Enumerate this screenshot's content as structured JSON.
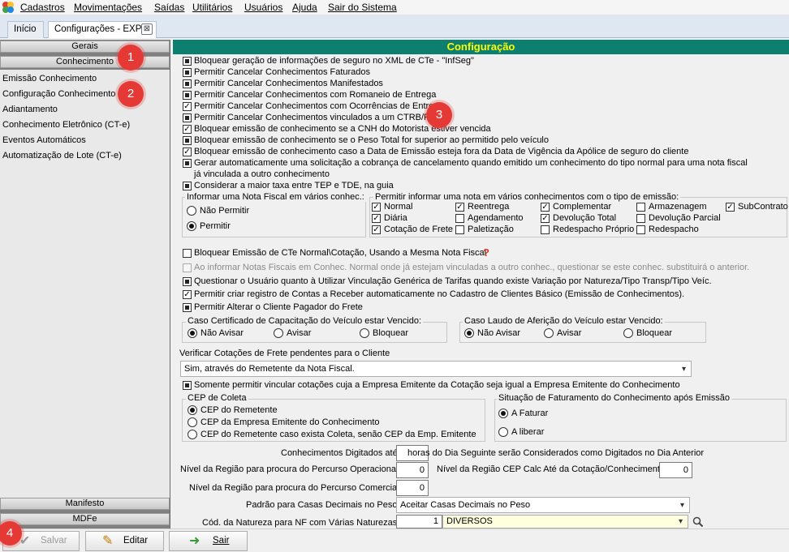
{
  "menu": [
    "Cadastros",
    "Movimentações",
    "Saídas",
    "Utilitários",
    "Usuários",
    "Ajuda",
    "Sair do Sistema"
  ],
  "tabs": [
    "Início",
    "Configurações - EXP"
  ],
  "tab_close_glyph": "⊠",
  "sidebar": {
    "groups_top": [
      "Gerais",
      "Conhecimento"
    ],
    "items": [
      "Emissão Conhecimento",
      "Configuração Conhecimento",
      "Adiantamento",
      "Conhecimento Eletrônico (CT-e)",
      "Eventos Automáticos",
      "Automatização de Lote (CT-e)"
    ],
    "groups_bottom": [
      "Manifesto",
      "MDFe"
    ]
  },
  "badges": [
    "1",
    "2",
    "3",
    "4"
  ],
  "header": "Configuração",
  "options": [
    {
      "label": "Bloquear geração de informações de seguro no XML de CTe - \"InfSeg\"",
      "state": "filled"
    },
    {
      "label": "Permitir Cancelar Conhecimentos Faturados",
      "state": "filled"
    },
    {
      "label": "Permitir Cancelar Conhecimentos Manifestados",
      "state": "filled"
    },
    {
      "label": "Permitir Cancelar Conhecimentos com Romaneio de Entrega",
      "state": "filled"
    },
    {
      "label": "Permitir Cancelar Conhecimentos com Ocorrências de Entrega",
      "state": "checked"
    },
    {
      "label": "Permitir Cancelar Conhecimentos vinculados a um CTRB/RPA",
      "state": "filled"
    },
    {
      "label": "Bloquear emissão de conhecimento se a CNH do Motorista estiver vencida",
      "state": "checked"
    },
    {
      "label": "Bloquear emissão de conhecimento se o Peso Total for superior ao permitido pelo veículo",
      "state": "filled"
    },
    {
      "label": "Bloquear emissão de conhecimento caso a Data de Emissão esteja fora da Data de Vigência da Apólice de seguro do cliente",
      "state": "checked"
    },
    {
      "label": "Gerar automaticamente uma solicitação a cobrança de cancelamento quando emitido um conhecimento do tipo normal para uma nota fiscal",
      "label2": "já vinculada a outro conhecimento",
      "state": "filled"
    },
    {
      "label": "Considerar a maior taxa entre TEP e TDE, na guia",
      "state": "filled"
    }
  ],
  "nf_group": {
    "title": "Informar uma Nota Fiscal em vários conhec.:",
    "options": [
      {
        "label": "Não Permitir",
        "selected": false
      },
      {
        "label": "Permitir",
        "selected": true
      }
    ]
  },
  "tipo_group": {
    "title": "Permitir informar uma nota em vários conhecimentos com o tipo de emissão:",
    "items": [
      {
        "label": "Normal",
        "checked": true
      },
      {
        "label": "Reentrega",
        "checked": true
      },
      {
        "label": "Complementar",
        "checked": true
      },
      {
        "label": "Armazenagem",
        "checked": false
      },
      {
        "label": "SubContrato",
        "checked": true
      },
      {
        "label": "Diária",
        "checked": true
      },
      {
        "label": "Agendamento",
        "checked": false
      },
      {
        "label": "Devolução Total",
        "checked": true
      },
      {
        "label": "Devolução Parcial",
        "checked": false
      },
      {
        "label": "Cotação de Frete",
        "checked": true
      },
      {
        "label": "Paletização",
        "checked": false
      },
      {
        "label": "Redespacho Próprio",
        "checked": false
      },
      {
        "label": "Redespacho",
        "checked": false
      }
    ]
  },
  "bloquear_cte": "Bloquear Emissão de CTe Normal\\Cotação, Usando a Mesma Nota Fiscal",
  "help_glyph": "?",
  "ao_informar": "Ao informar Notas Fiscais em Conhec. Normal onde já estejam vinculadas a outro conhec., questionar se este conhec. substituirá o anterior.",
  "options2": [
    {
      "label": "Questionar o Usuário quanto à Utilizar Vinculação Genérica de Tarifas quando existe Variação por Natureza/Tipo Transp/Tipo Veíc.",
      "state": "filled"
    },
    {
      "label": "Permitir criar  registro de Contas a Receber automaticamente no Cadastro de Clientes Básico (Emissão de Conhecimentos).",
      "state": "checked"
    },
    {
      "label": "Permitir Alterar o Cliente Pagador do Frete",
      "state": "filled"
    }
  ],
  "cert_group": {
    "title": "Caso Certificado de Capacitação do Veículo estar Vencido:",
    "options": [
      {
        "label": "Não Avisar",
        "selected": true
      },
      {
        "label": "Avisar",
        "selected": false
      },
      {
        "label": "Bloquear",
        "selected": false
      }
    ]
  },
  "laudo_group": {
    "title": "Caso Laudo de Aferição do Veículo estar Vencido:",
    "options": [
      {
        "label": "Não Avisar",
        "selected": true
      },
      {
        "label": "Avisar",
        "selected": false
      },
      {
        "label": "Bloquear",
        "selected": false
      }
    ]
  },
  "cotacoes": {
    "label": "Verificar Cotações de Frete pendentes para o Cliente",
    "value": "Sim, através do Remetente da Nota Fiscal."
  },
  "somente_vincular": "Somente permitir vincular cotações cuja a Empresa Emitente da Cotação seja igual a Empresa Emitente do Conhecimento",
  "cep_group": {
    "title": "CEP de Coleta",
    "options": [
      {
        "label": "CEP do Remetente",
        "selected": true
      },
      {
        "label": "CEP da Empresa Emitente do Conhecimento",
        "selected": false
      },
      {
        "label": "CEP do Remetente caso exista Coleta, senão CEP da Emp. Emitente",
        "selected": false
      }
    ]
  },
  "fat_group": {
    "title": "Situação de Faturamento do Conhecimento após Emissão",
    "options": [
      {
        "label": "A Faturar",
        "selected": true
      },
      {
        "label": "A liberar",
        "selected": false
      }
    ]
  },
  "fields": {
    "digitados_label": "Conhecimentos Digitados até",
    "digitados_value": "",
    "digitados_suffix": "horas do Dia Seguinte serão Considerados como Digitados no Dia Anterior",
    "nivel_oper_label": "Nível da Região para procura do Percurso Operacional",
    "nivel_oper_value": "0",
    "nivel_cep_label": "Nível da Região CEP Calc Até da Cotação/Conhecimento",
    "nivel_cep_value": "0",
    "nivel_com_label": "Nível da Região para procura do Percurso Comercial",
    "nivel_com_value": "0",
    "padrao_label": "Padrão para Casas Decimais no Peso",
    "padrao_value": "Aceitar Casas Decimais no Peso",
    "natureza_label": "Cód. da Natureza para NF com Várias Naturezas",
    "natureza_code": "1",
    "natureza_desc": "DIVERSOS"
  },
  "buttons": {
    "salvar": "Salvar",
    "editar": "Editar",
    "sair": "Sair"
  },
  "colors": {
    "header_bg": "#0d7f70",
    "header_fg": "#ffff00",
    "badge": "#e53935",
    "sidebar": "#808080"
  }
}
